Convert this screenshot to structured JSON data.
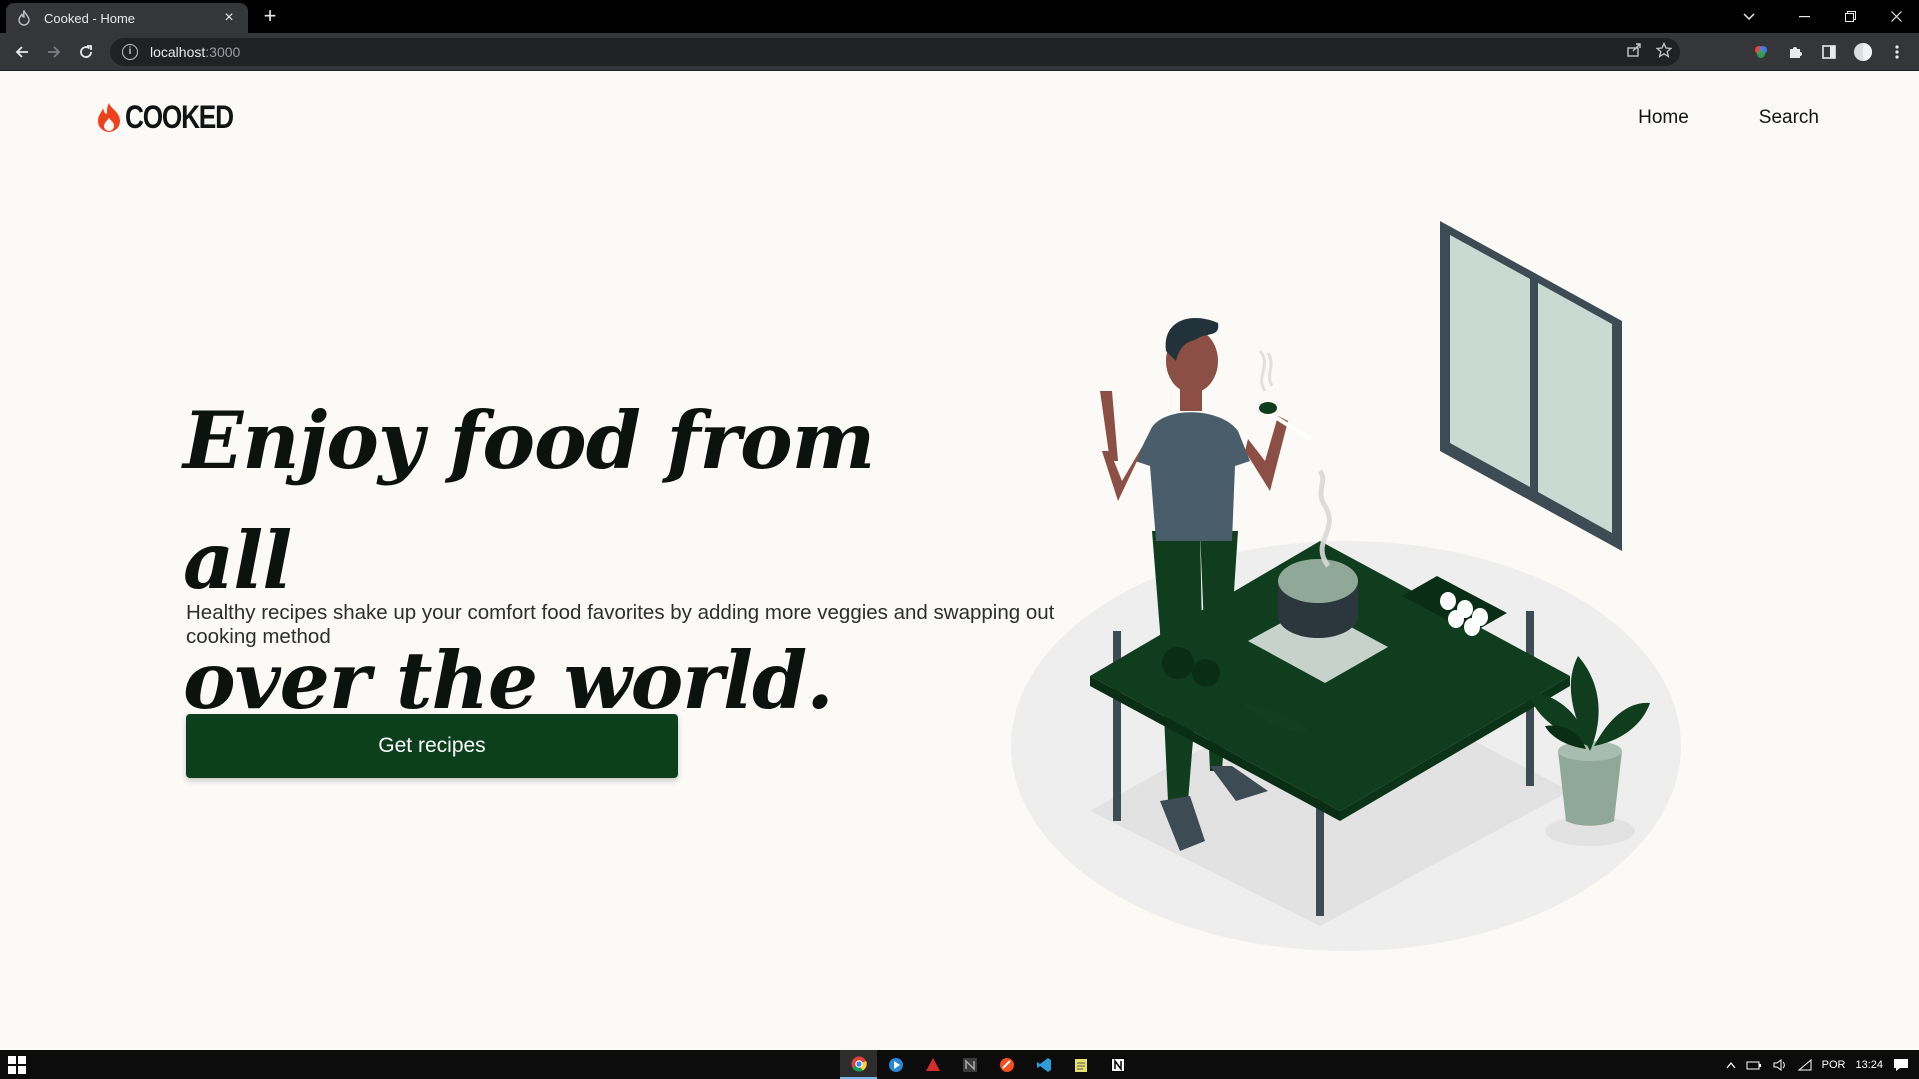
{
  "browser": {
    "tab_title": "Cooked - Home",
    "tab_close": "×",
    "new_tab": "+",
    "url_host": "localhost",
    "url_port": ":3000"
  },
  "site": {
    "logo_text": "COOKED",
    "nav": [
      {
        "label": "Home"
      },
      {
        "label": "Search"
      }
    ]
  },
  "hero": {
    "headline_line1": "Enjoy food from all",
    "headline_line2": "over the world.",
    "subtext": "Healthy recipes shake up your comfort food favorites by adding more veggies and swapping out cooking method",
    "cta_label": "Get recipes"
  },
  "taskbar": {
    "language": "POR",
    "time": "13:24"
  },
  "colors": {
    "background": "#fcfaf6",
    "primary_green": "#0c3f1c",
    "logo_flame": "#f0411d",
    "text_dark": "#0c1210"
  }
}
